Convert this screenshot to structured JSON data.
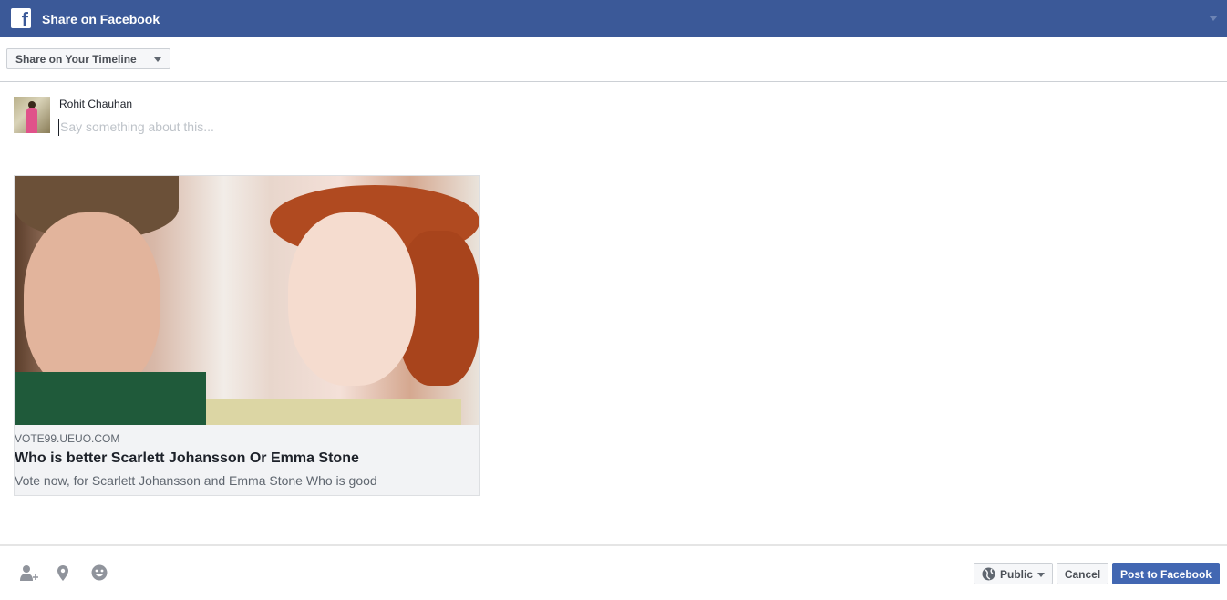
{
  "header": {
    "title": "Share on Facebook",
    "logo": "f"
  },
  "share_target": {
    "selected": "Share on Your Timeline"
  },
  "composer": {
    "user_name": "Rohit Chauhan",
    "placeholder": "Say something about this..."
  },
  "link_card": {
    "domain": "VOTE99.UEUO.COM",
    "title": "Who is better Scarlett Johansson Or Emma Stone",
    "description": "Vote now, for Scarlett Johansson and Emma Stone Who is good"
  },
  "footer": {
    "icons": [
      "tag-friends-icon",
      "location-pin-icon",
      "emoji-icon"
    ],
    "audience": "Public",
    "cancel": "Cancel",
    "post": "Post to Facebook"
  },
  "colors": {
    "brand": "#3b5998",
    "button": "#4267b2"
  }
}
